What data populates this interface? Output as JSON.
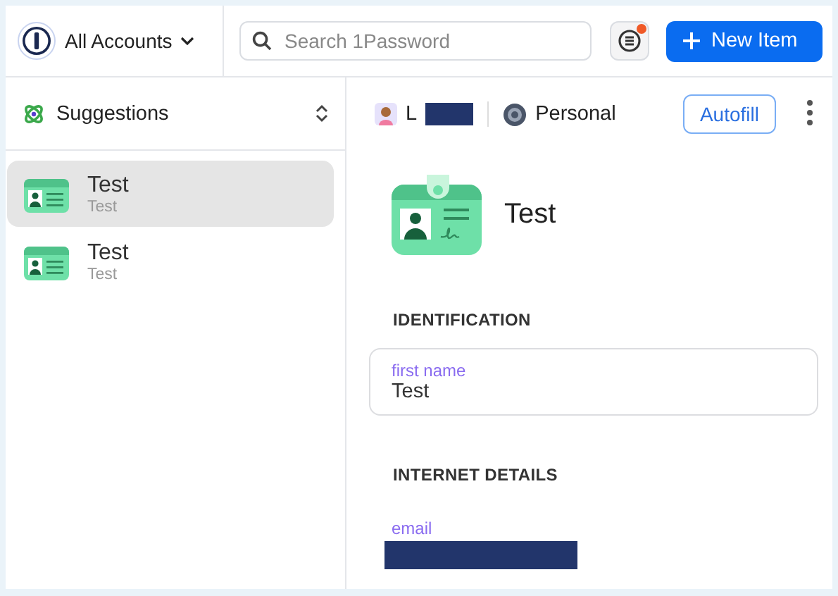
{
  "header": {
    "account_menu": "All Accounts",
    "search": {
      "placeholder": "Search 1Password"
    },
    "notification": true,
    "new_item_button": "New Item"
  },
  "sidebar": {
    "filter": "Suggestions",
    "items": [
      {
        "title": "Test",
        "subtitle": "Test",
        "selected": true
      },
      {
        "title": "Test",
        "subtitle": "Test",
        "selected": false
      }
    ]
  },
  "detail": {
    "account": "L",
    "account_redacted": true,
    "vault": "Personal",
    "autofill_button": "Autofill",
    "title": "Test",
    "sections": [
      {
        "heading": "IDENTIFICATION",
        "fields": [
          {
            "kind": "boxed",
            "label": "first name",
            "value": "Test"
          }
        ]
      },
      {
        "heading": "INTERNET DETAILS",
        "fields": [
          {
            "kind": "redacted",
            "label": "email"
          }
        ]
      }
    ]
  }
}
